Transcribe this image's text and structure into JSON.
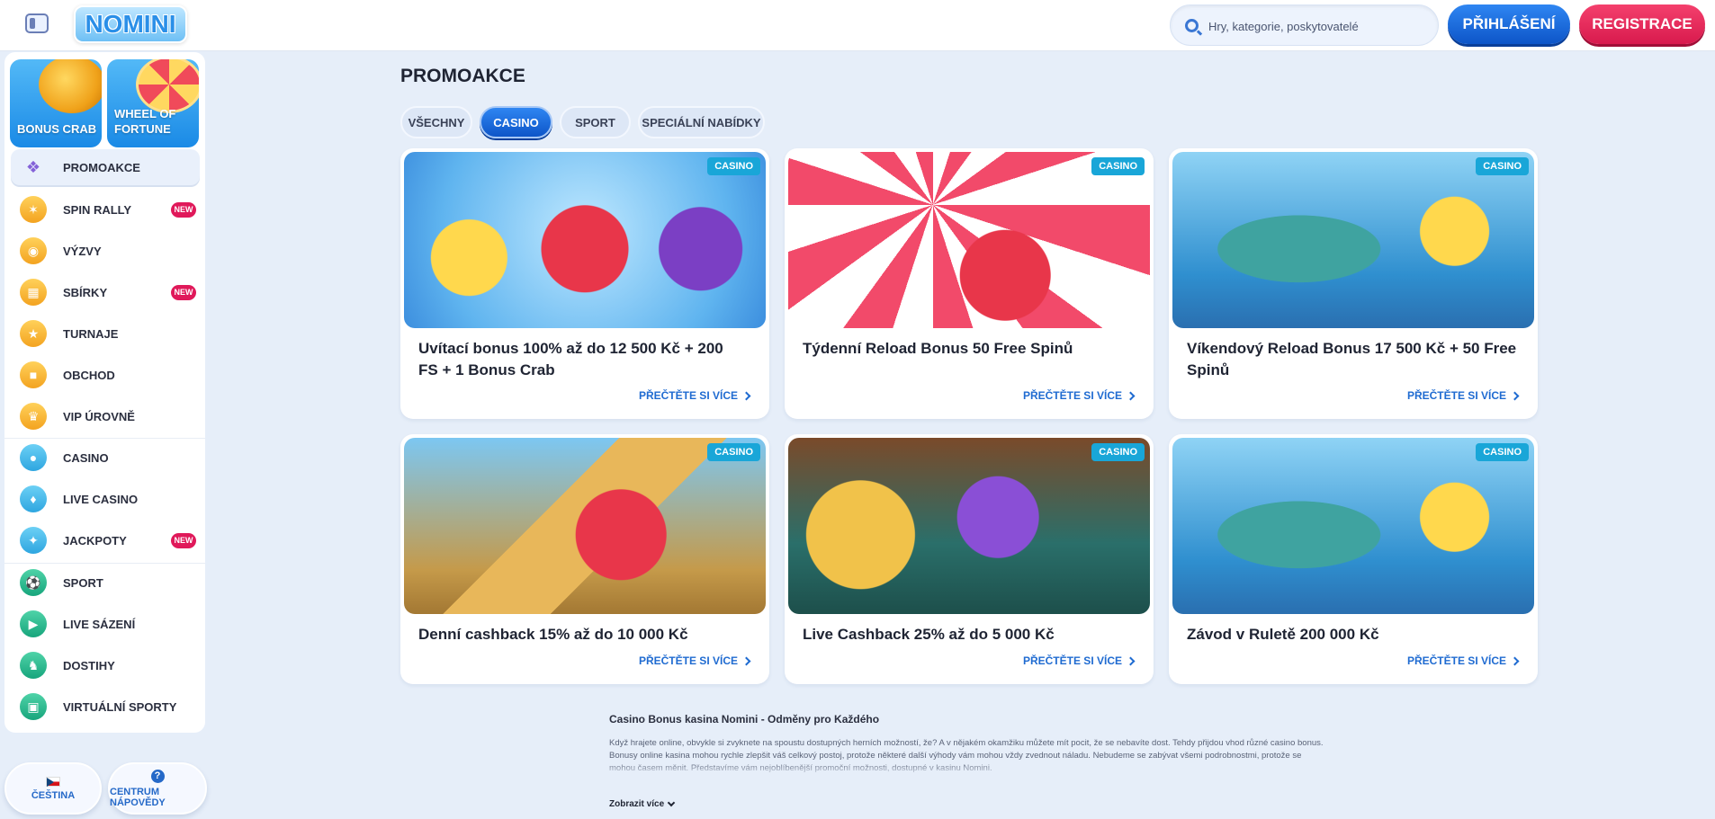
{
  "header": {
    "logo_text": "NOMINI",
    "search_placeholder": "Hry, kategorie, poskytovatelé",
    "login_label": "PŘIHLÁŠENÍ",
    "register_label": "REGISTRACE"
  },
  "sidebar": {
    "tiles": [
      {
        "label": "BONUS CRAB"
      },
      {
        "label": "WHEEL OF FORTUNE"
      }
    ],
    "items": [
      {
        "label": "PROMOAKCE",
        "icon": "gift-icon",
        "active": true
      },
      {
        "label": "SPIN RALLY",
        "icon": "spin-rally-icon",
        "badge": "NEW"
      },
      {
        "label": "VÝZVY",
        "icon": "challenge-icon"
      },
      {
        "label": "SBÍRKY",
        "icon": "collection-icon",
        "badge": "NEW"
      },
      {
        "label": "TURNAJE",
        "icon": "trophy-icon"
      },
      {
        "label": "OBCHOD",
        "icon": "shop-icon"
      },
      {
        "label": "VIP ÚROVNĚ",
        "icon": "crown-icon"
      },
      {
        "label": "CASINO",
        "icon": "cherry-icon"
      },
      {
        "label": "LIVE CASINO",
        "icon": "live-casino-icon"
      },
      {
        "label": "JACKPOTY",
        "icon": "jackpot-icon",
        "badge": "NEW"
      },
      {
        "label": "SPORT",
        "icon": "football-icon"
      },
      {
        "label": "LIVE SÁZENÍ",
        "icon": "live-betting-icon"
      },
      {
        "label": "DOSTIHY",
        "icon": "horse-icon"
      },
      {
        "label": "VIRTUÁLNÍ SPORTY",
        "icon": "virtual-sports-icon"
      }
    ],
    "language_label": "ČEŠTINA",
    "help_label": "CENTRUM NÁPOVĚDY"
  },
  "main": {
    "title": "PROMOAKCE",
    "tabs": [
      {
        "label": "VŠECHNY"
      },
      {
        "label": "CASINO",
        "active": true
      },
      {
        "label": "SPORT"
      },
      {
        "label": "SPECIÁLNÍ NABÍDKY"
      }
    ],
    "cards": [
      {
        "tag": "CASINO",
        "title": "Uvítací bonus 100% až do 12 500 Kč + 200 FS + 1 Bonus Crab",
        "link": "PŘEČTĚTE SI VÍCE"
      },
      {
        "tag": "CASINO",
        "title": "Týdenní Reload Bonus 50 Free Spinů",
        "link": "PŘEČTĚTE SI VÍCE"
      },
      {
        "tag": "CASINO",
        "title": "Víkendový Reload Bonus 17 500 Kč + 50 Free Spinů",
        "link": "PŘEČTĚTE SI VÍCE"
      },
      {
        "tag": "CASINO",
        "title": "Denní cashback 15% až do 10 000 Kč",
        "link": "PŘEČTĚTE SI VÍCE"
      },
      {
        "tag": "CASINO",
        "title": "Live Cashback 25% až do 5 000 Kč",
        "link": "PŘEČTĚTE SI VÍCE"
      },
      {
        "tag": "CASINO",
        "title": "Závod v Ruletě 200 000 Kč",
        "link": "PŘEČTĚTE SI VÍCE"
      }
    ]
  },
  "seo": {
    "title": "Casino Bonus kasina Nomini - Odměny pro Každého",
    "text": "Když hrajete online, obvykle si zvyknete na spoustu dostupných herních možností, že? A v nějakém okamžiku můžete mít pocit, že se nebavíte dost. Tehdy přijdou vhod různé casino bonus. Bonusy online kasina mohou rychle zlepšit váš celkový postoj, protože některé další výhody vám mohou vždy zvednout náladu. Nebudeme se zabývat všemi podrobnostmi, protože se mohou časem měnit. Představíme vám nejoblíbenější promoční možnosti, dostupné v kasinu Nomini.",
    "more_label": "Zobrazit více"
  }
}
